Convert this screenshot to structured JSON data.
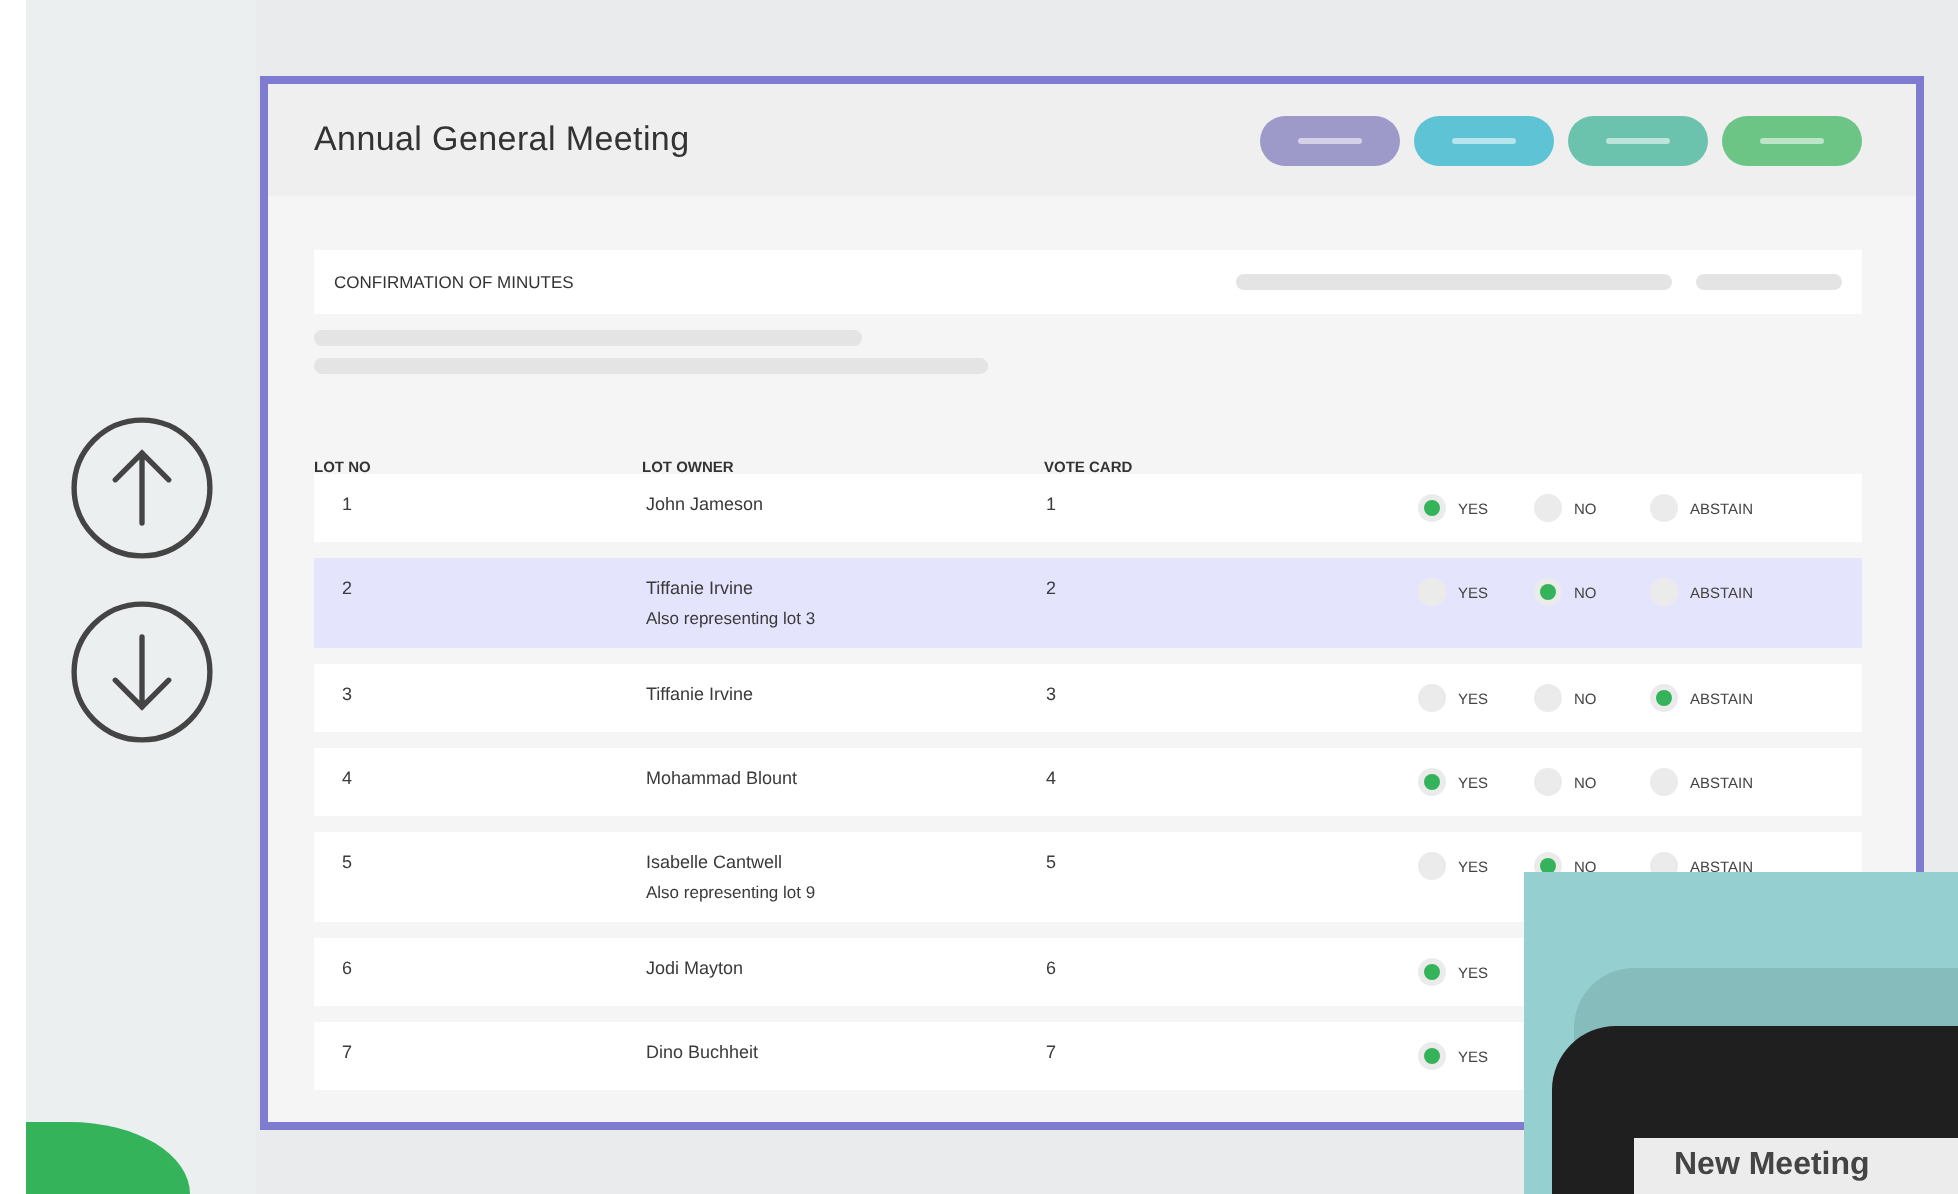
{
  "sidebar": {
    "buttons": [
      {
        "kind": "up"
      },
      {
        "kind": "down"
      }
    ]
  },
  "meeting": {
    "title": "Annual General Meeting",
    "action_buttons": [
      {
        "color": "#9d99c9"
      },
      {
        "color": "#5ec3d4"
      },
      {
        "color": "#6cc3ad"
      },
      {
        "color": "#6cc585"
      }
    ],
    "section": {
      "title": "CONFIRMATION OF MINUTES"
    },
    "table": {
      "columns": [
        "LOT NO",
        "LOT OWNER",
        "VOTE CARD"
      ],
      "rows": [
        {
          "lot_no": "1",
          "owner": "John Jameson",
          "vote_card": "1",
          "selected": false,
          "votes": [
            {
              "label": "YES",
              "selected": true
            },
            {
              "label": "NO",
              "selected": false
            },
            {
              "label": "ABSTAIN",
              "selected": false
            }
          ]
        },
        {
          "lot_no": "2",
          "owner": "Tiffanie Irvine",
          "note": "Also representing lot 3",
          "vote_card": "2",
          "selected": true,
          "votes": [
            {
              "label": "YES",
              "selected": false
            },
            {
              "label": "NO",
              "selected": true
            },
            {
              "label": "ABSTAIN",
              "selected": false
            }
          ]
        },
        {
          "lot_no": "3",
          "owner": "Tiffanie Irvine",
          "vote_card": "3",
          "selected": false,
          "votes": [
            {
              "label": "YES",
              "selected": false
            },
            {
              "label": "NO",
              "selected": false
            },
            {
              "label": "ABSTAIN",
              "selected": true
            }
          ]
        },
        {
          "lot_no": "4",
          "owner": "Mohammad Blount",
          "vote_card": "4",
          "selected": false,
          "votes": [
            {
              "label": "YES",
              "selected": true
            },
            {
              "label": "NO",
              "selected": false
            },
            {
              "label": "ABSTAIN",
              "selected": false
            }
          ]
        },
        {
          "lot_no": "5",
          "owner": "Isabelle Cantwell",
          "note": "Also representing lot 9",
          "vote_card": "5",
          "selected": false,
          "votes": [
            {
              "label": "YES",
              "selected": false
            },
            {
              "label": "NO",
              "selected": true
            },
            {
              "label": "ABSTAIN",
              "selected": false
            }
          ]
        },
        {
          "lot_no": "6",
          "owner": "Jodi Mayton",
          "vote_card": "6",
          "selected": false,
          "votes": [
            {
              "label": "YES",
              "selected": true
            }
          ]
        },
        {
          "lot_no": "7",
          "owner": "Dino Buchheit",
          "vote_card": "7",
          "selected": false,
          "votes": [
            {
              "label": "YES",
              "selected": true
            }
          ]
        }
      ]
    }
  },
  "overlay": {
    "title": "New Meeting"
  }
}
